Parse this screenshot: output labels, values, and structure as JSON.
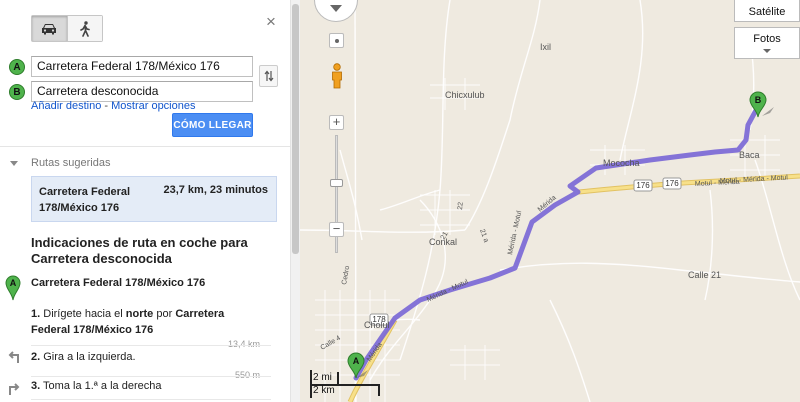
{
  "panel": {
    "close_label": "×",
    "travel_modes": [
      {
        "name": "car",
        "icon": "car-icon",
        "active": true
      },
      {
        "name": "walk",
        "icon": "walk-icon",
        "active": false
      }
    ],
    "origin": {
      "marker": "A",
      "value": "Carretera Federal 178/México 176"
    },
    "destination": {
      "marker": "B",
      "value": "Carretera desconocida"
    },
    "add_destination_label": "Añadir destino",
    "link_separator": " - ",
    "show_options_label": "Mostrar opciones",
    "submit_label": "CÓMO LLEGAR",
    "suggested_routes_label": "Rutas sugeridas",
    "route": {
      "name": "Carretera Federal 178/México 176",
      "summary": "23,7 km, 23 minutos"
    },
    "directions_title": "Indicaciones de ruta en coche para Carretera desconocida",
    "start_marker": "A",
    "start_name": "Carretera Federal 178/México 176",
    "steps": [
      {
        "number": "1.",
        "text_a": "Dirígete hacia el ",
        "bold_a": "norte",
        "text_b": " por ",
        "bold_b": "Carretera Federal 178/México 176",
        "distance": "13,4 km",
        "icon": "straight-icon"
      },
      {
        "number": "2.",
        "text": "Gira a la izquierda.",
        "distance": "550 m",
        "icon": "turn-left-icon"
      },
      {
        "number": "3.",
        "text": "Toma la 1.ª a la derecha",
        "distance": "",
        "icon": "turn-right-icon"
      }
    ]
  },
  "map": {
    "satellite_label": "Satélite",
    "photos_label": "Fotos",
    "scale_mi": "2 mi",
    "scale_km": "2 km",
    "marker_a": "A",
    "marker_b": "B",
    "labels": {
      "ixil": "Ixil",
      "chicxulub": "Chicxulub",
      "mococha": "Mococha",
      "baca": "Baca",
      "conkal": "Conkal",
      "cholul": "Cholul",
      "cedro": "Cedro",
      "calle21": "Calle 21",
      "calle4": "Calle 4",
      "road176a": "176",
      "road176b": "176",
      "road178": "178",
      "road22": "22",
      "road21": "21",
      "road21a": "21 a",
      "merida1": "Mérida",
      "merida2": "Mérida",
      "motul1": "Motul - Mérida",
      "motul2": "Motul - Mérida - Motul",
      "merida_motul1": "Mérida - Motul",
      "merida_motul2": "Mérida - Motul",
      "merida_motul3": "Mérida - Motul"
    },
    "colors": {
      "route": "#7b68d6",
      "highway": "#f4d774",
      "marker": "#4fb34c",
      "button_primary": "#4c8ef3"
    }
  }
}
